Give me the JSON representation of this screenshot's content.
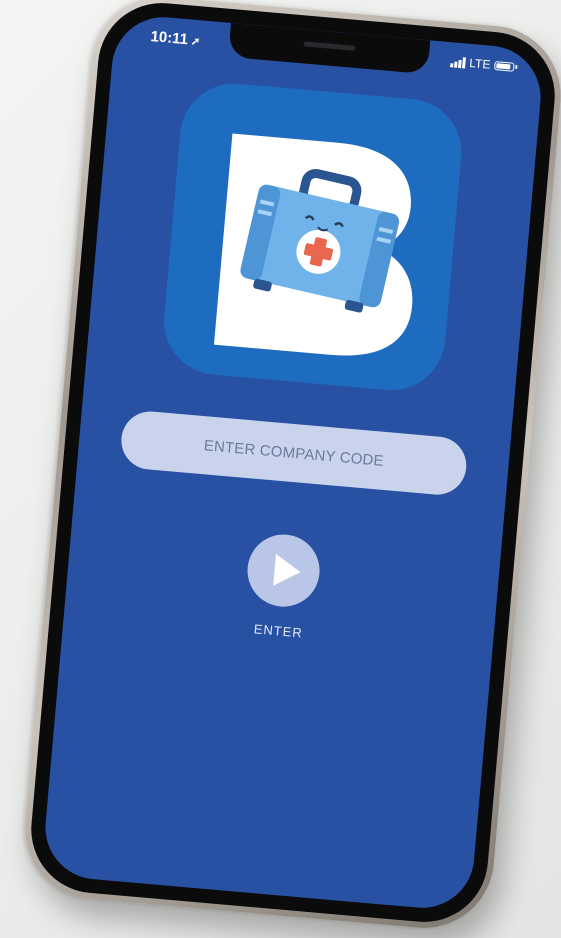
{
  "status_bar": {
    "time": "10:11",
    "network": "LTE"
  },
  "app": {
    "logo_letter": "B",
    "icon_name": "first-aid-kit-icon"
  },
  "login": {
    "company_code_placeholder": "ENTER COMPANY CODE",
    "company_code_value": "",
    "enter_label": "ENTER"
  },
  "colors": {
    "screen_background": "#2850a3",
    "app_icon_background": "#1e6cc0",
    "input_background": "#c9d4ec",
    "button_background": "#b9c6e8"
  }
}
